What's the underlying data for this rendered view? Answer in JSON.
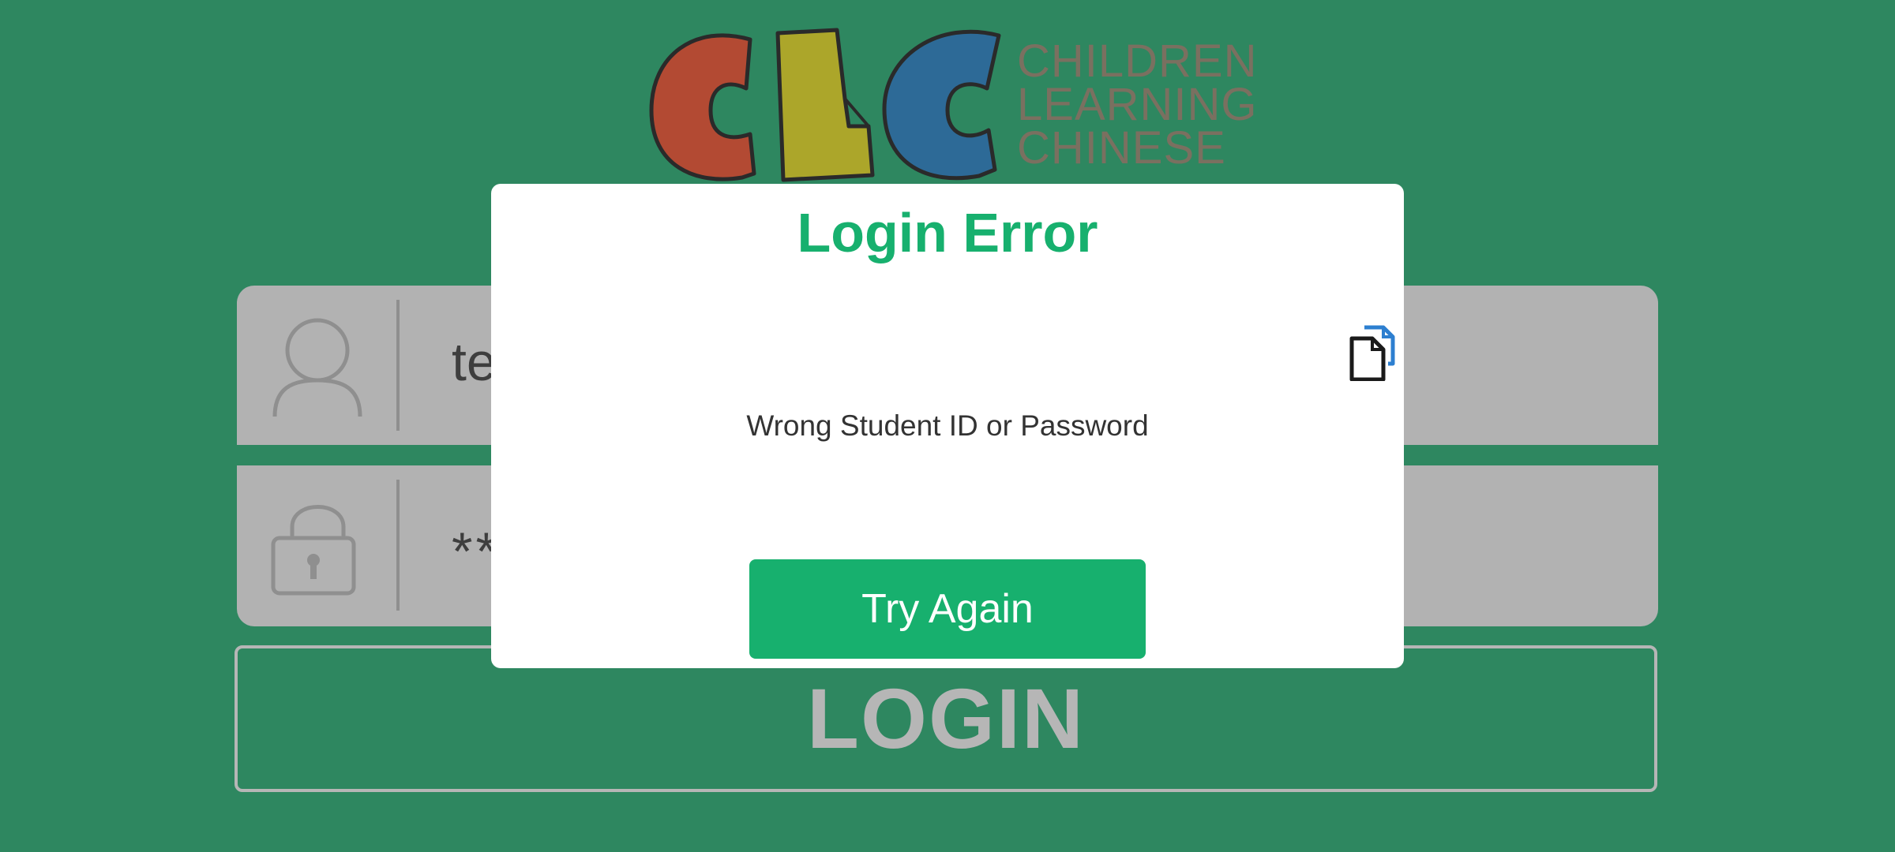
{
  "logo": {
    "letters": "CLC",
    "line1": "CHILDREN",
    "line2": "LEARNING",
    "line3": "CHINESE",
    "colors": {
      "c1": "#b34a33",
      "l": "#aca62a",
      "c2": "#2d6a97",
      "text": "#7a7060"
    }
  },
  "form": {
    "username_value": "te",
    "password_value": "**",
    "user_icon": "user-icon",
    "lock_icon": "lock-icon",
    "login_label": "LOGIN"
  },
  "dialog": {
    "title": "Login Error",
    "message": "Wrong Student ID or Password",
    "button_label": "Try Again",
    "copy_icon": "copy-icon"
  },
  "colors": {
    "background": "#2e8760",
    "accent": "#17b06e",
    "field": "#b2b2b2"
  }
}
